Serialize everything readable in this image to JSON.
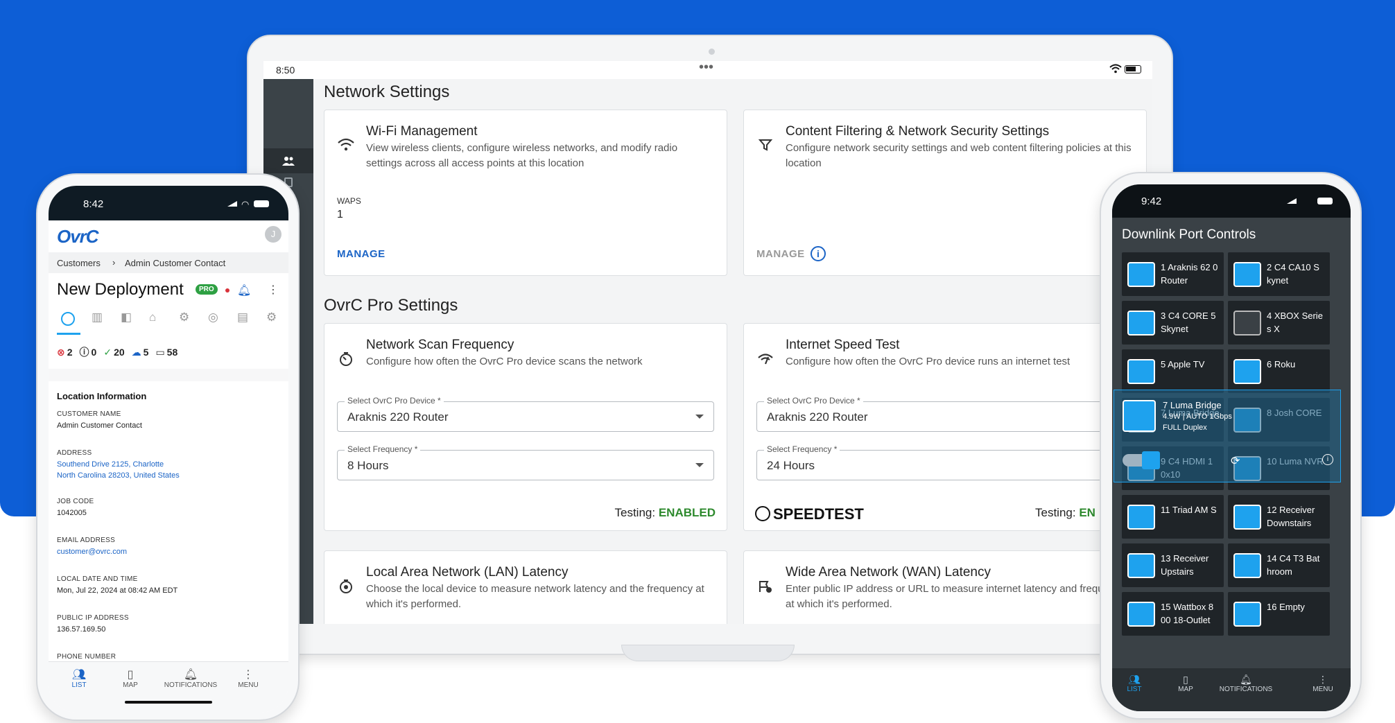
{
  "laptop": {
    "time": "8:50",
    "dots": "•••",
    "page_title": "Network Settings",
    "wifi_card": {
      "title": "Wi-Fi Management",
      "description": "View wireless clients, configure wireless networks, and modify radio settings across all access points at this location",
      "waps_label": "WAPS",
      "waps_value": "1",
      "manage": "MANAGE"
    },
    "content_card": {
      "title": "Content Filtering & Network Security Settings",
      "description": "Configure network security settings and web content filtering policies at this location",
      "manage": "MANAGE"
    },
    "pro_title": "OvrC Pro Settings",
    "scan_card": {
      "title": "Network Scan Frequency",
      "description": "Configure how often the OvrC Pro device scans the network",
      "device_label": "Select OvrC Pro Device *",
      "device_value": "Araknis 220 Router",
      "freq_label": "Select Frequency *",
      "freq_value": "8 Hours",
      "testing_label": "Testing:",
      "testing_value": "ENABLED"
    },
    "speed_card": {
      "title": "Internet Speed Test",
      "description": "Configure how often the OvrC Pro device runs an internet test",
      "device_label": "Select OvrC Pro Device *",
      "device_value": "Araknis 220 Router",
      "freq_label": "Select Frequency *",
      "freq_value": "24 Hours",
      "logo": "SPEEDTEST",
      "testing_label": "Testing:",
      "testing_value": "EN"
    },
    "lan_card": {
      "title": "Local Area Network (LAN) Latency",
      "description": "Choose the local device to measure network latency and the frequency at which it's performed."
    },
    "wan_card": {
      "title": "Wide Area Network (WAN) Latency",
      "description": "Enter public IP address or URL to measure internet latency and frequency at which it's performed."
    }
  },
  "left_phone": {
    "time": "8:42",
    "logo": "OvrC",
    "avatar": "J",
    "breadcrumb": [
      "Customers",
      "Admin Customer Contact"
    ],
    "title": "New Deployment",
    "pro_badge": "PRO",
    "stats": [
      {
        "icon": "error-icon",
        "value": "2",
        "color": "#d9323a"
      },
      {
        "icon": "warning-icon",
        "value": "0",
        "color": "#333333"
      },
      {
        "icon": "check-icon",
        "value": "20",
        "color": "#2ea043"
      },
      {
        "icon": "cloud-icon",
        "value": "5",
        "color": "#1b64c6"
      },
      {
        "icon": "devices-icon",
        "value": "58",
        "color": "#333333"
      }
    ],
    "section": "Location Information",
    "fields": {
      "customer_name_label": "CUSTOMER NAME",
      "customer_name": "Admin Customer Contact",
      "address_label": "ADDRESS",
      "address_1": "Southend Drive 2125, Charlotte",
      "address_2": "North Carolina 28203, United States",
      "job_code_label": "JOB CODE",
      "job_code": "1042005",
      "email_label": "EMAIL ADDRESS",
      "email": "customer@ovrc.com",
      "local_dt_label": "LOCAL DATE AND TIME",
      "local_dt": "Mon, Jul 22, 2024 at 08:42 AM EDT",
      "public_ip_label": "PUBLIC IP ADDRESS",
      "public_ip": "136.57.169.50",
      "phone_label": "PHONE NUMBER"
    },
    "nav": [
      "LIST",
      "MAP",
      "NOTIFICATIONS",
      "MENU"
    ]
  },
  "right_phone": {
    "time": "9:42",
    "title": "Downlink Port Controls",
    "ports": [
      {
        "label": "1 Araknis 62 0 Router"
      },
      {
        "label": "2 C4 CA10 S kynet"
      },
      {
        "label": "3 C4 CORE 5 Skynet"
      },
      {
        "label": "4 XBOX Serie s X"
      },
      {
        "label": "5 Apple TV"
      },
      {
        "label": "6 Roku"
      },
      {
        "label": "7 Luma Bridge"
      },
      {
        "label": "8 Josh CORE"
      },
      {
        "label": "9 C4 HDMI 1 0x10"
      },
      {
        "label": "10 Luma NVR"
      },
      {
        "label": "11 Triad AM S"
      },
      {
        "label": "12 Receiver Downstairs"
      },
      {
        "label": "13 Receiver Upstairs"
      },
      {
        "label": "14 C4 T3 Bat hroom"
      },
      {
        "label": "15 Wattbox 8 00 18-Outlet"
      },
      {
        "label": "16 Empty"
      }
    ],
    "popup_detail_1": "4.9W | AUTO 1Gbps",
    "popup_detail_2": "FULL Duplex",
    "nav": [
      "LIST",
      "MAP",
      "NOTIFICATIONS",
      "MENU"
    ]
  },
  "colors": {
    "brand_blue": "#0d5ed6",
    "enabled_green": "#2e8a2e",
    "port_blue": "#1ea2ee"
  }
}
